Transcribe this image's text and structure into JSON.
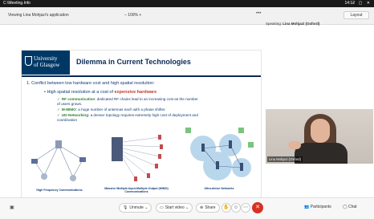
{
  "titlebar": {
    "title": "C:\\Meeting.Info",
    "time": "14:12",
    "controls": "– ▢ ✕"
  },
  "header": {
    "share_label": "Viewing Lina Mohjazi's application",
    "zoom": "– 100% +",
    "more": "•••",
    "speaking_prefix": "Speaking:",
    "speaking_name": "Lina Mohjazi (Oxford)",
    "layout_button": "Layout"
  },
  "slide": {
    "university_line1": "University",
    "university_line2": "of Glasgow",
    "title": "Dilemma in Current Technologies",
    "point1": "1.  Conflict between low hardware cost and high spatial resolution:",
    "point2_prefix": "High spatial resolution at a cost of ",
    "point2_emphasis": "expensive hardware",
    "subpoints": [
      {
        "key": "RF communication",
        "text": ": dedicated RF chains lead to an increasing cost as the number of users grows."
      },
      {
        "key": "M-MIMO",
        "text": ": a huge number of antennas each with a phase shifter."
      },
      {
        "key": "UD-Networking",
        "text": ": a denser topology requires extremely high cost of deployment and coordination"
      }
    ],
    "diagram_captions": [
      "High Frequency Communications",
      "Massive Multiple-Input-Multiple-Output (MIMO) Communications",
      "Ultra-dense Networks"
    ]
  },
  "video": {
    "participant_name": "Lina Mohjazi (Oxford)"
  },
  "toolbar": {
    "chat_icon": "chat-bubble-icon",
    "unmute": "Unmute",
    "start_video": "Start video",
    "share": "Share",
    "participants": "Participants",
    "chat": "Chat",
    "end_icon": "✕"
  },
  "colors": {
    "brand_navy": "#003865",
    "end_red": "#d93025",
    "accent_green": "#2f7d32",
    "emphasis_red": "#c0392b"
  }
}
